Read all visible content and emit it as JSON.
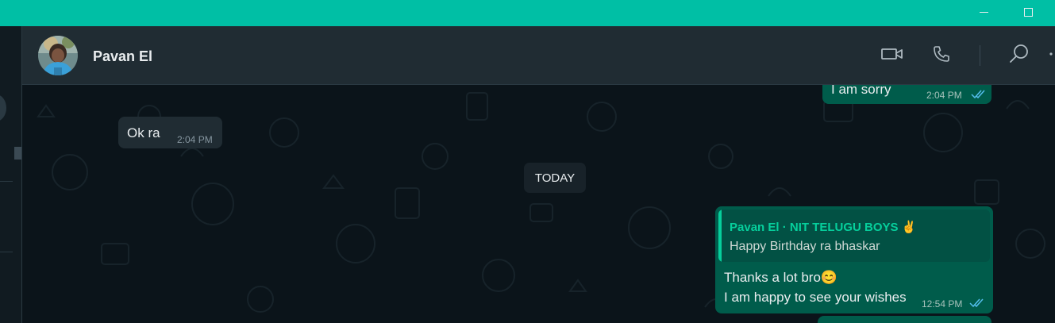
{
  "window": {
    "accent_color": "#00bfa5",
    "controls": [
      "minimize-icon",
      "maximize-icon"
    ]
  },
  "header": {
    "contact_name": "Pavan El",
    "icons": [
      "video-call-icon",
      "voice-call-icon",
      "search-icon",
      "menu-dots-icon"
    ]
  },
  "messages": [
    {
      "direction": "outgoing",
      "text": "I am sorry",
      "time": "2:04 PM",
      "status": "read"
    },
    {
      "direction": "incoming",
      "text": "Ok ra",
      "time": "2:04 PM"
    },
    {
      "type": "date-separator",
      "label": "TODAY"
    },
    {
      "direction": "outgoing",
      "quote": {
        "author": "Pavan El · NIT TELUGU BOYS ✌",
        "text": "Happy Birthday ra bhaskar"
      },
      "line1": "Thanks a lot bro😊",
      "line2": "I am happy to see your wishes",
      "time": "12:54 PM",
      "status": "read"
    }
  ],
  "colors": {
    "chat_background": "#0b141a",
    "header_background": "#202c33",
    "incoming_bubble": "#202c33",
    "outgoing_bubble": "#005c4b",
    "read_ticks": "#53bdeb"
  }
}
